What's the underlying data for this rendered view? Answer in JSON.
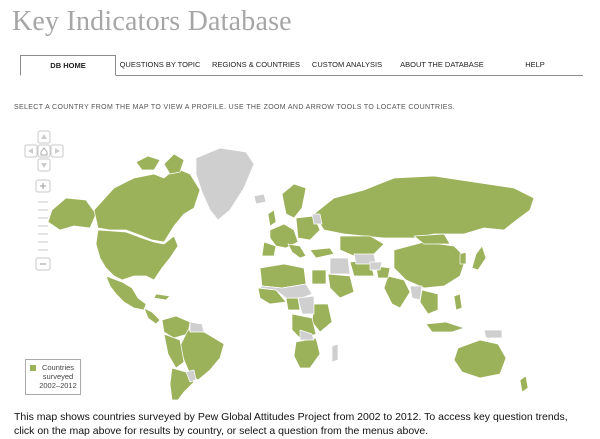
{
  "page": {
    "title": "Key Indicators Database"
  },
  "nav": {
    "tabs": [
      {
        "label": "DB HOME",
        "active": true
      },
      {
        "label": "QUESTIONS BY TOPIC"
      },
      {
        "label": "REGIONS & COUNTRIES"
      },
      {
        "label": "CUSTOM ANALYSIS"
      },
      {
        "label": "ABOUT THE DATABASE"
      },
      {
        "label": "HELP"
      }
    ]
  },
  "instructions": "SELECT A COUNTRY FROM THE MAP TO VIEW A PROFILE. USE THE ZOOM AND ARROW TOOLS TO LOCATE COUNTRIES.",
  "legend": {
    "line1": "Countries",
    "line2": "surveyed",
    "line3": "2002–2012"
  },
  "caption": "This map shows countries surveyed by Pew Global Attitudes Project from 2002 to 2012. To access key question trends, click on the map above for results by country, or select a question from the menus above.",
  "colors": {
    "surveyed": "#9bb15a",
    "not_surveyed": "#cfcfcf",
    "border": "#ffffff"
  }
}
